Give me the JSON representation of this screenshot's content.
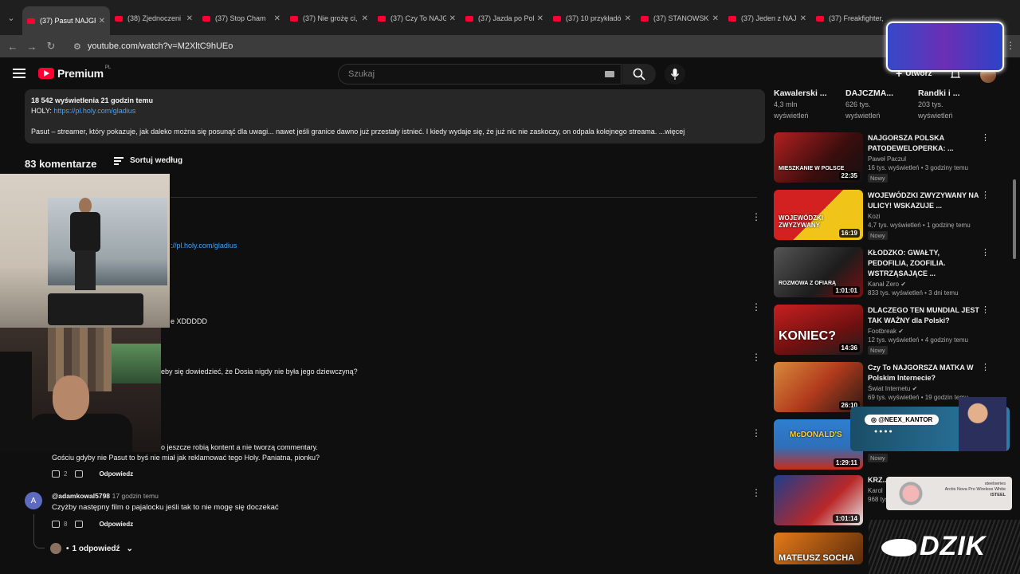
{
  "tabs": [
    {
      "title": "(37) Pasut NAJGR"
    },
    {
      "title": "(38) Zjednoczeni"
    },
    {
      "title": "(37) Stop Cham"
    },
    {
      "title": "(37) Nie grożę ci,"
    },
    {
      "title": "(37) Czy To NAJG"
    },
    {
      "title": "(37) Jazda po Pol"
    },
    {
      "title": "(37) 10 przykładó"
    },
    {
      "title": "(37) STANOWSKI"
    },
    {
      "title": "(37) Jeden z NAJ"
    },
    {
      "title": "(37) Freakfighter,"
    }
  ],
  "address": {
    "url": "youtube.com/watch?v=M2XltC9hUEo"
  },
  "header": {
    "logo": "Premium",
    "region": "PL",
    "search_placeholder": "Szukaj",
    "create_label": "Utwórz"
  },
  "description": {
    "stats": "18 542 wyświetlenia  21 godzin temu",
    "holy_label": "HOLY: ",
    "holy_link": "https://pl.holy.com/gladius",
    "text": "Pasut – streamer, który pokazuje, jak daleko można się posunąć dla uwagi... nawet jeśli granice dawno już przestały istnieć. I kiedy wydaje się, że już nic nie zaskoczy, on odpala kolejnego streama. ...więcej"
  },
  "comments_header": {
    "count": "83 komentarze",
    "sort_label": "Sortuj według"
  },
  "comment_fragments": {
    "link1": "://pl.holy.com/gladius",
    "frag2": "e XDDDDD",
    "frag3": "eby się dowiedzieć, że Dosia nigdy nie była jego dziewczyną?",
    "frag4a": "o jeszcze robią kontent a nie tworzą commentary.",
    "frag4b": "Gościu gdyby nie Pasut to byś nie miał jak reklamować tego Holy. Paniatna, pionku?",
    "likes4": "2",
    "reply": "Odpowiedz"
  },
  "comment5": {
    "avatar_letter": "A",
    "author": "@adamkowal5798",
    "time": "17 godzin temu",
    "text": "Czyżby następny film o pajalocku jeśli tak to nie mogę się doczekać",
    "likes": "8",
    "reply": "Odpowiedz",
    "replies_label": "1 odpowiedź"
  },
  "sidebar_top": [
    {
      "title": "Kawalerski ...",
      "views": "4,3 mln",
      "views2": "wyświetleń"
    },
    {
      "title": "DAJCZMA...",
      "views": "626 tys.",
      "views2": "wyświetleń"
    },
    {
      "title": "Randki i ...",
      "views": "203 tys.",
      "views2": "wyświetleń"
    }
  ],
  "recommended": [
    {
      "title": "NAJGORSZA POLSKA PATODEWELOPERKA: ...",
      "channel": "Paweł Paczul",
      "views": "16 tys. wyświetleń • 3 godziny temu",
      "badge": "Nowy",
      "duration": "22:35",
      "caption": "MIESZKANIE W POLSCE"
    },
    {
      "title": "WOJEWÓDZKI ZWYZYWANY NA ULICY! WSKAZUJE ...",
      "channel": "Kozi",
      "views": "4,7 tys. wyświetleń • 1 godzinę temu",
      "badge": "Nowy",
      "duration": "16:19",
      "caption": "WOJEWÓDZKI ZWYZYWANY"
    },
    {
      "title": "KŁODZKO: GWAŁTY, PEDOFILIA, ZOOFILIA. WSTRZĄSAJĄCE ...",
      "channel": "Kanał Zero",
      "views": "833 tys. wyświetleń • 3 dni temu",
      "badge": "",
      "duration": "1:01:01",
      "caption": "ROZMOWA Z OFIARĄ"
    },
    {
      "title": "DLACZEGO TEN MUNDIAL JEST TAK WAŻNY dla Polski?",
      "channel": "Footbreak",
      "views": "12 tys. wyświetleń • 4 godziny temu",
      "badge": "Nowy",
      "duration": "14:36",
      "caption": "KONIEC?"
    },
    {
      "title": "Czy To NAJGORSZA MATKA W Polskim Internecie?",
      "channel": "Świat Internetu",
      "views": "69 tys. wyświetleń • 19 godzin temu",
      "badge": "",
      "duration": "26:10",
      "caption": ""
    },
    {
      "title": "",
      "channel": "",
      "views": "",
      "badge": "Nowy",
      "duration": "1:29:11",
      "caption": "McDONALD'S"
    },
    {
      "title": "KRZ... MAF...",
      "channel": "Karol",
      "views": "968 tys. wyświetleń • 23 godziny temu",
      "badge": "",
      "duration": "1:01:14",
      "caption": ""
    },
    {
      "title": "",
      "channel": "",
      "views": "",
      "badge": "",
      "duration": "",
      "caption": "MATEUSZ SOCHA"
    }
  ],
  "overlays": {
    "kantor_handle": "@NEEX_KANTOR",
    "steel_brand": "steelseries",
    "steel_product": "Arctis Nova Pro Wireless White",
    "steel_tag": "ISTEEL",
    "dzik_logo": "DZIK"
  },
  "colors": {
    "bg": "#0f0f0f",
    "accent": "#ff0033",
    "link": "#3ea6ff"
  }
}
